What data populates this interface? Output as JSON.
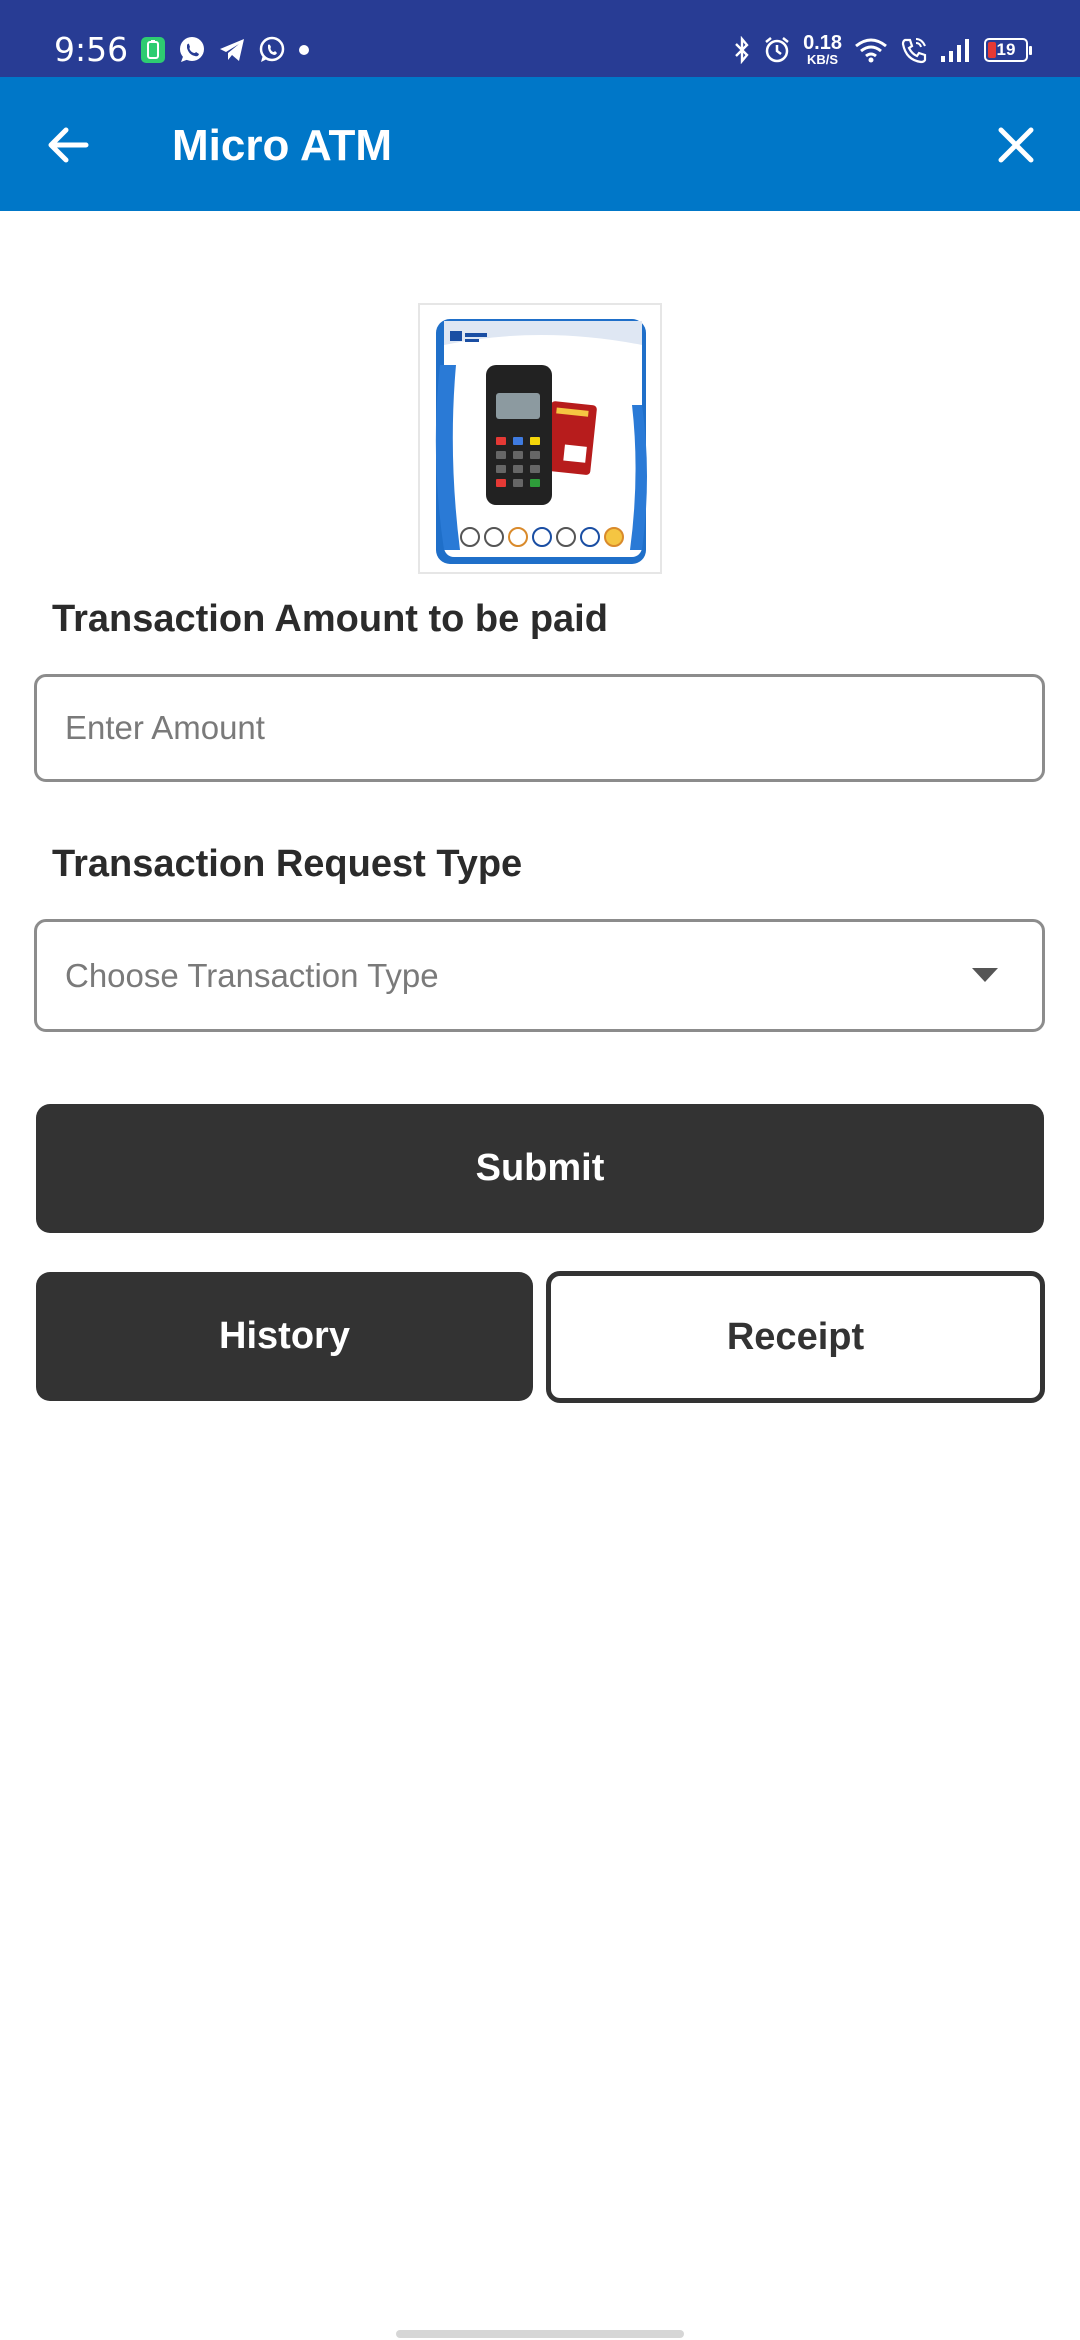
{
  "status_bar": {
    "time": "9:56",
    "left_icons": [
      "battery-saver-icon",
      "whatsapp-icon",
      "telegram-icon",
      "whatsapp-icon",
      "dot-icon"
    ],
    "net_speed_value": "0.18",
    "net_speed_unit": "KB/S",
    "battery_level": "19",
    "right_icons": [
      "bluetooth-icon",
      "alarm-icon",
      "wifi-icon",
      "wifi-call-icon",
      "signal-icon"
    ]
  },
  "app_bar": {
    "title": "Micro ATM",
    "back_icon": "arrow-left-icon",
    "close_icon": "close-icon",
    "background": "#0077c8"
  },
  "form": {
    "amount_label": "Transaction Amount to be paid",
    "amount_placeholder": "Enter Amount",
    "amount_value": "",
    "type_label": "Transaction Request Type",
    "type_placeholder": "Choose Transaction Type"
  },
  "buttons": {
    "submit": "Submit",
    "history": "History",
    "receipt": "Receipt"
  },
  "colors": {
    "status_bar": "#283c94",
    "app_bar": "#0077c8",
    "button_dark": "#333333"
  }
}
